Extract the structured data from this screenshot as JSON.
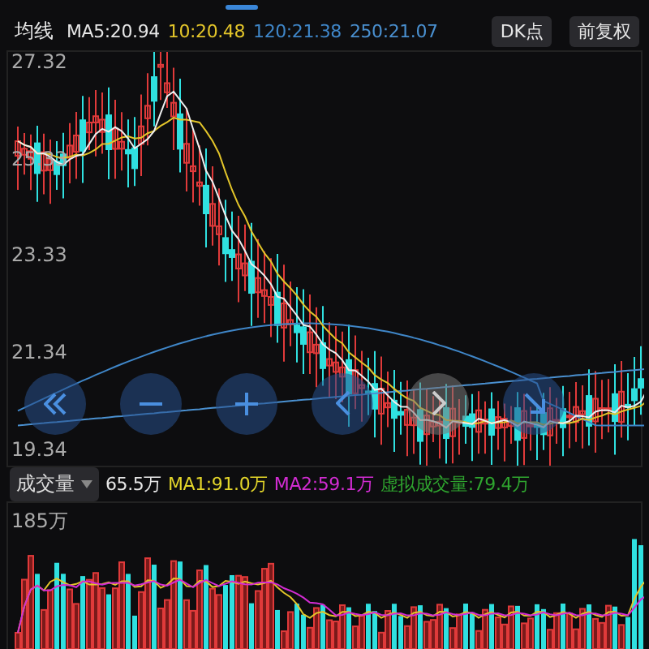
{
  "header": {
    "title": "均线",
    "indicators": [
      {
        "text": "MA5:20.94",
        "color": "#e6e6e6"
      },
      {
        "text": "10:20.48",
        "color": "#e3c52a"
      },
      {
        "text": "120:21.38",
        "color": "#3f86c8"
      },
      {
        "text": "250:21.07",
        "color": "#4a90d0"
      }
    ],
    "buttons": [
      "DK点",
      "前复权"
    ]
  },
  "price_axis": [
    "27.32",
    "25.33",
    "23.33",
    "21.34",
    "19.34"
  ],
  "controls": [
    {
      "kind": "rewind",
      "disabled": false
    },
    {
      "kind": "zoom-out",
      "disabled": false
    },
    {
      "kind": "zoom-in",
      "disabled": false
    },
    {
      "kind": "prev",
      "disabled": false
    },
    {
      "kind": "next",
      "disabled": true
    },
    {
      "kind": "latest",
      "disabled": false
    }
  ],
  "volume_header": {
    "selector": "成交量",
    "indicators": [
      {
        "text": "65.5万",
        "color": "#e6e6e6"
      },
      {
        "text": "MA1:91.0万",
        "color": "#e3d52a"
      },
      {
        "text": "MA2:59.1万",
        "color": "#d22cd2"
      },
      {
        "text": "虚拟成交量:79.4万",
        "color": "#2fa52f"
      }
    ]
  },
  "volume_axis": "185万"
}
